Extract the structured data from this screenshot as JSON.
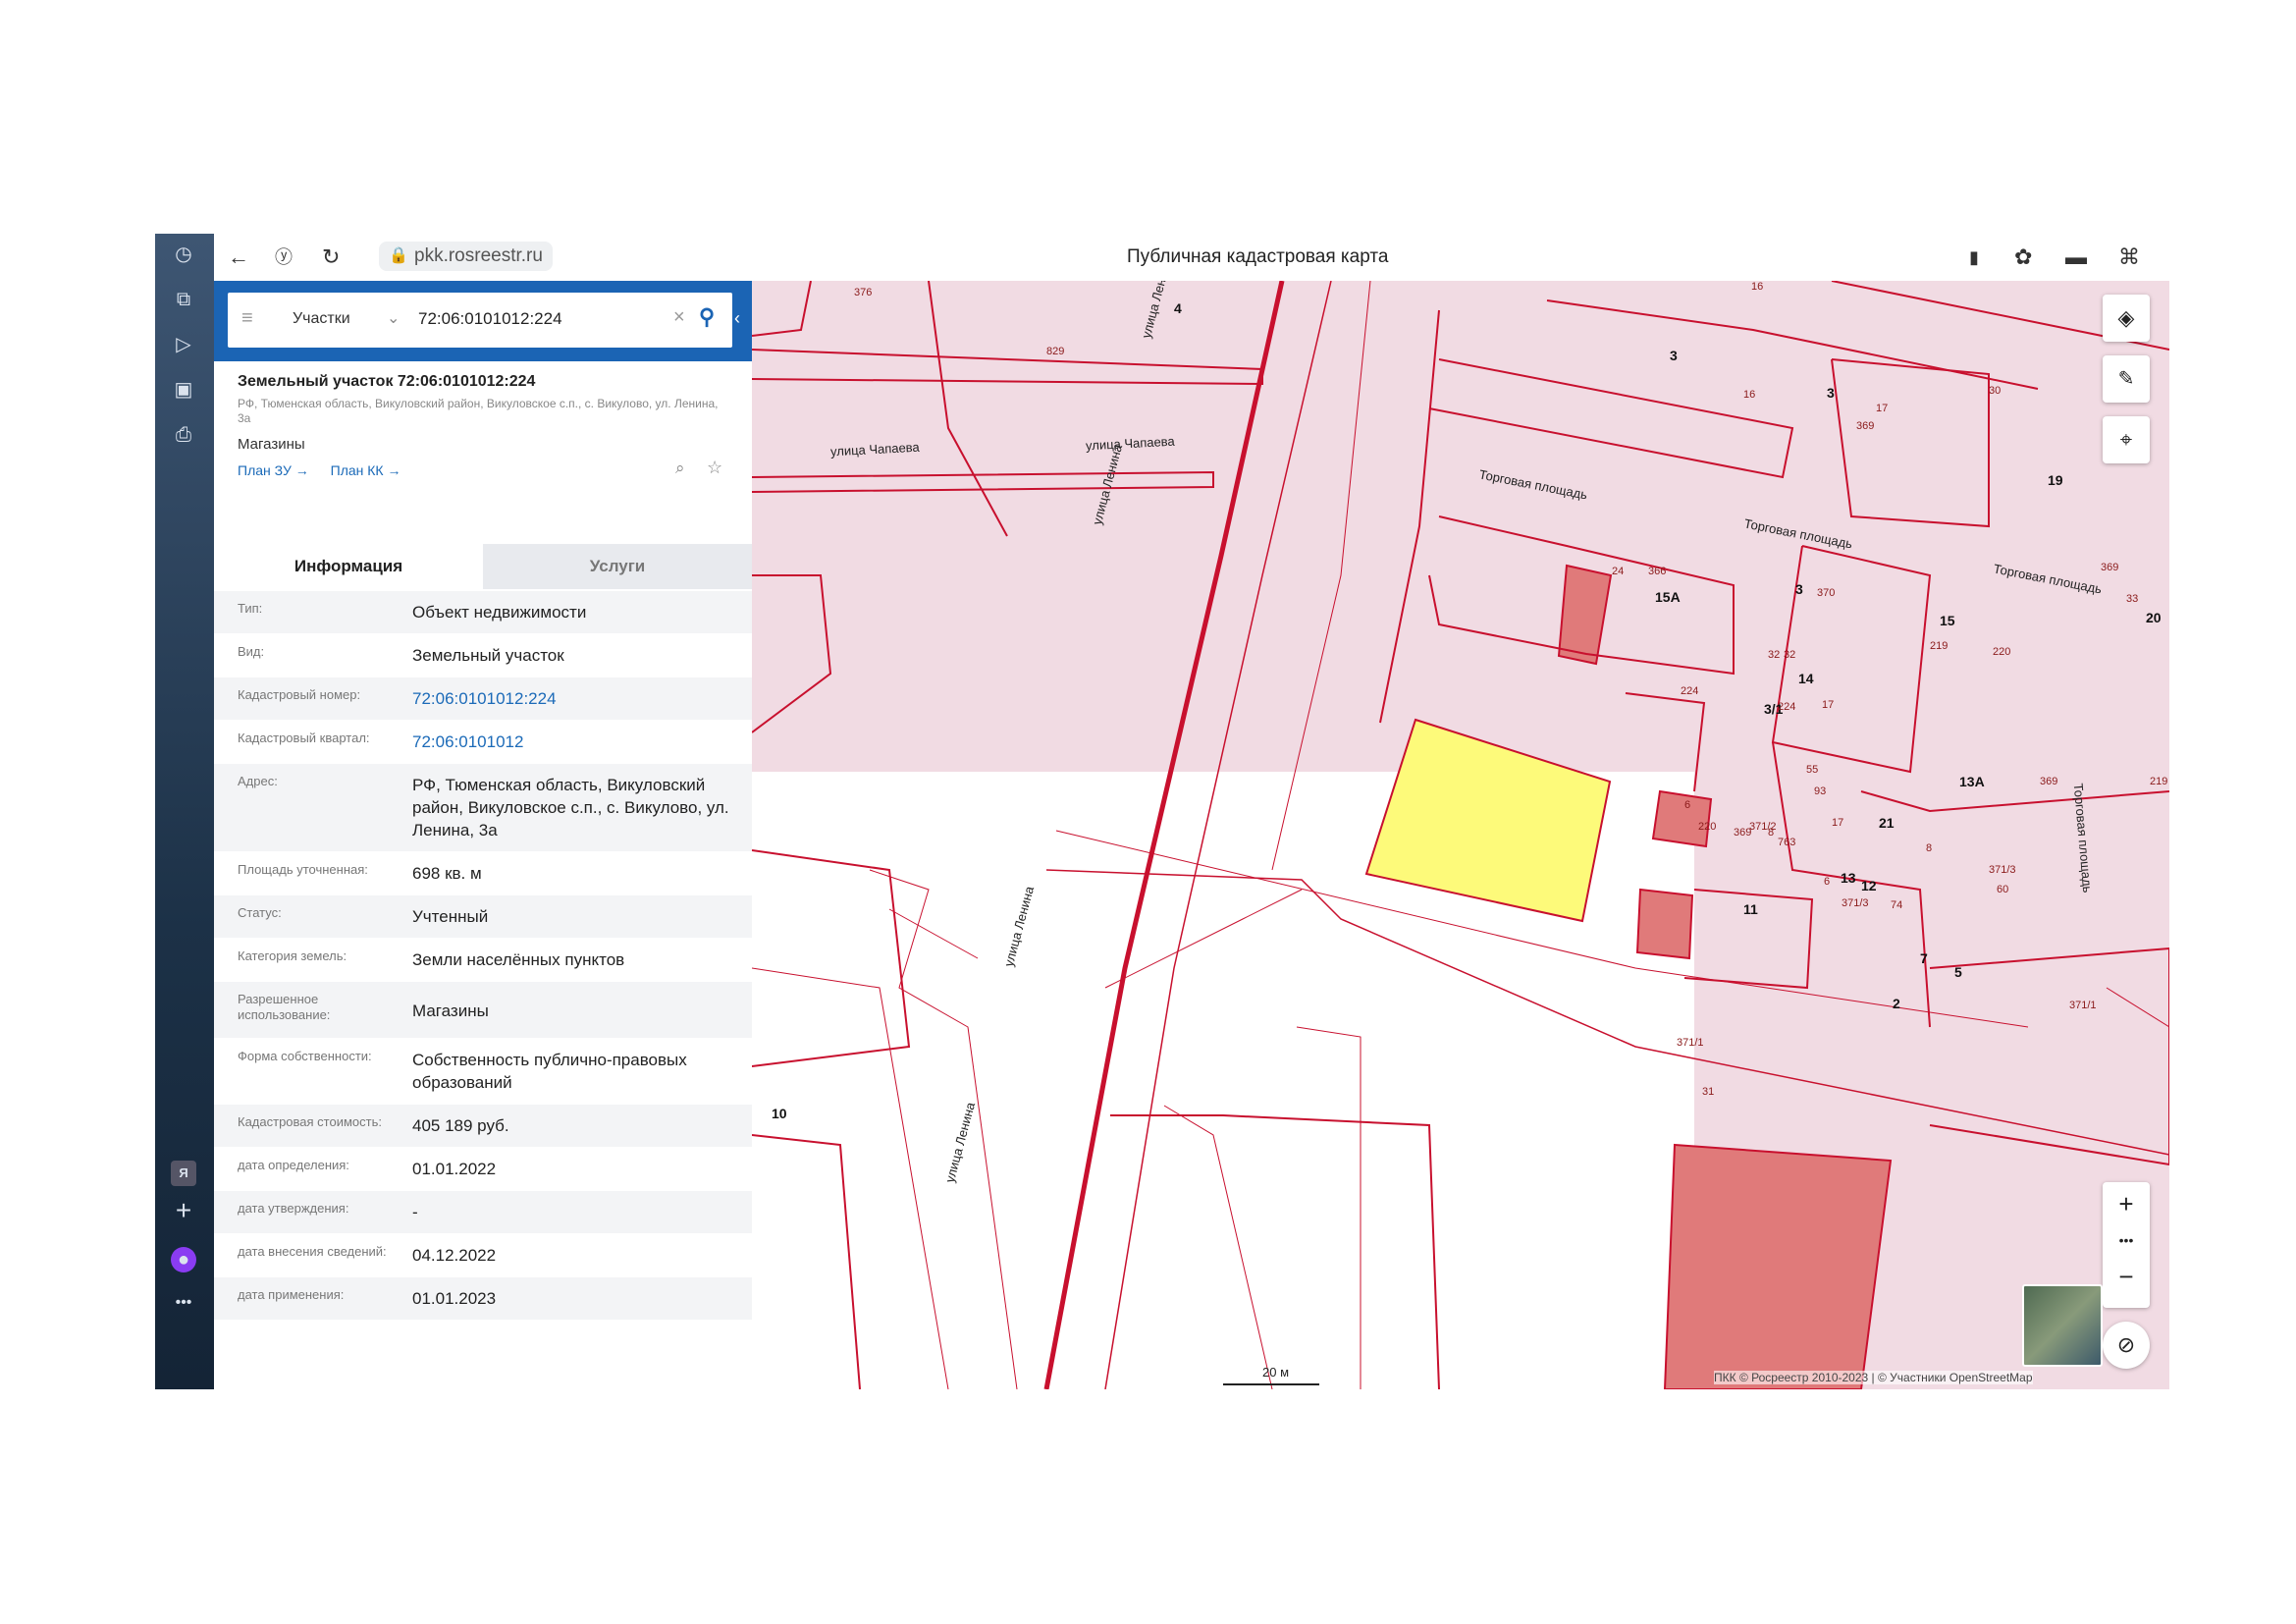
{
  "browser": {
    "url": "pkk.rosreestr.ru",
    "page_title": "Публичная кадастровая карта"
  },
  "search": {
    "category": "Участки",
    "query": "72:06:0101012:224"
  },
  "card": {
    "title": "Земельный участок 72:06:0101012:224",
    "address_short": "РФ, Тюменская область, Викуловский район, Викуловское с.п., с. Викулово, ул. Ленина, 3а",
    "usage": "Магазины",
    "link_plan_zu": "План ЗУ →",
    "link_plan_kk": "План КК →"
  },
  "tabs": {
    "info": "Информация",
    "services": "Услуги"
  },
  "info_rows": [
    {
      "label": "Тип:",
      "value": "Объект недвижимости"
    },
    {
      "label": "Вид:",
      "value": "Земельный участок"
    },
    {
      "label": "Кадастровый номер:",
      "value": "72:06:0101012:224"
    },
    {
      "label": "Кадастровый квартал:",
      "value": "72:06:0101012"
    },
    {
      "label": "Адрес:",
      "value": "РФ, Тюменская область, Викуловский район, Викуловское с.п., с. Викулово, ул. Ленина, 3а"
    },
    {
      "label": "Площадь уточненная:",
      "value": "698 кв. м"
    },
    {
      "label": "Статус:",
      "value": "Учтенный"
    },
    {
      "label": "Категория земель:",
      "value": "Земли населённых пунктов"
    },
    {
      "label": "Разрешенное использование:",
      "value": "Магазины"
    },
    {
      "label": "Форма собственности:",
      "value": "Собственность публично-правовых образований"
    },
    {
      "label": "Кадастровая стоимость:",
      "value": "405 189 руб."
    },
    {
      "label": "дата определения:",
      "value": "01.01.2022"
    },
    {
      "label": "дата утверждения:",
      "value": "-"
    },
    {
      "label": "дата внесения сведений:",
      "value": "04.12.2022"
    },
    {
      "label": "дата применения:",
      "value": "01.01.2023"
    }
  ],
  "map": {
    "streets": {
      "lenina": "улица Ленина",
      "chapaeva": "улица Чапаева",
      "torgovaya": "Торговая площадь"
    },
    "labels": [
      "4",
      "829",
      "376",
      "16",
      "3",
      "3",
      "30",
      "16",
      "17",
      "369",
      "19",
      "369",
      "24",
      "366",
      "15А",
      "3",
      "370",
      "15",
      "33",
      "20",
      "32",
      "32",
      "14",
      "219",
      "220",
      "3/1",
      "224",
      "224",
      "6",
      "17",
      "17",
      "55",
      "93",
      "13А",
      "369",
      "219",
      "21",
      "220",
      "369",
      "371/2",
      "8",
      "763",
      "8",
      "6",
      "13",
      "12",
      "11",
      "371/3",
      "371/3",
      "60",
      "7",
      "5",
      "74",
      "2",
      "371/1",
      "371/1",
      "31",
      "10"
    ],
    "scale": "20 м",
    "attribution": "ПКК © Росреестр 2010-2023 | © Участники OpenStreetMap"
  },
  "colors": {
    "accent": "#1b64b4",
    "parcel_fill": "#f1dbe3",
    "parcel_line": "#c8102e",
    "selected_fill": "#fdfa7a",
    "building_fill": "#e07a7a"
  }
}
